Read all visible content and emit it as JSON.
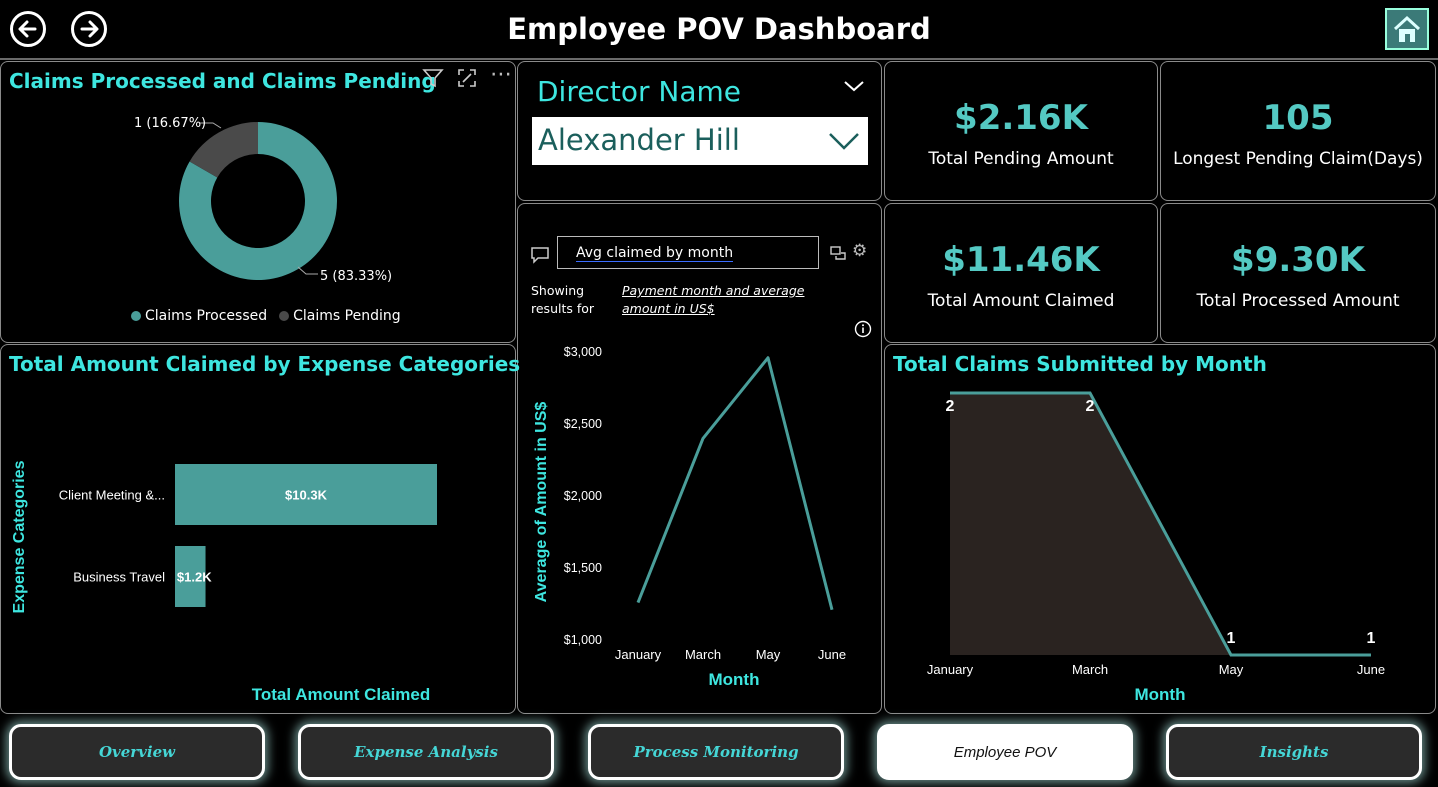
{
  "header": {
    "title": "Employee POV Dashboard",
    "back_icon": "arrow-left-icon",
    "forward_icon": "arrow-right-icon",
    "home_icon": "home-icon"
  },
  "claims_donut": {
    "title": "Claims Processed and Claims Pending",
    "pending_label": "1 (16.67%)",
    "processed_label": "5 (83.33%)",
    "legend_processed": "Claims Processed",
    "legend_pending": "Claims Pending",
    "colors": {
      "processed": "#4a9e9a",
      "pending": "#4a4a4a"
    }
  },
  "director": {
    "label": "Director Name",
    "selected": "Alexander Hill"
  },
  "kpis": [
    {
      "value": "$2.16K",
      "label": "Total Pending Amount"
    },
    {
      "value": "105",
      "label": "Longest Pending Claim(Days)"
    },
    {
      "value": "$11.46K",
      "label": "Total Amount Claimed"
    },
    {
      "value": "$9.30K",
      "label": "Total Processed Amount"
    }
  ],
  "qa": {
    "query": "Avg claimed by month",
    "showing": "Showing results for",
    "interpretation": "Payment month and average amount in US$"
  },
  "bar_chart": {
    "title": "Total Amount Claimed by Expense Categories",
    "xlabel": "Total Amount Claimed",
    "ylabel": "Expense Categories",
    "categories": [
      "Client Meeting &...",
      "Business Travel"
    ],
    "value_labels": [
      "$10.3K",
      "$1.2K"
    ]
  },
  "avg_chart": {
    "ylabel": "Average of Amount in US$",
    "xlabel": "Month",
    "y_ticks": [
      "$3,000",
      "$2,500",
      "$2,000",
      "$1,500",
      "$1,000"
    ],
    "x_ticks": [
      "January",
      "March",
      "May",
      "June"
    ]
  },
  "area_chart": {
    "title": "Total Claims Submitted by Month",
    "xlabel": "Month",
    "x_ticks": [
      "January",
      "March",
      "May",
      "June"
    ],
    "point_labels": [
      "2",
      "2",
      "1",
      "1"
    ]
  },
  "chart_data": [
    {
      "type": "pie",
      "title": "Claims Processed and Claims Pending",
      "categories": [
        "Claims Processed",
        "Claims Pending"
      ],
      "values": [
        5,
        1
      ]
    },
    {
      "type": "bar",
      "title": "Total Amount Claimed by Expense Categories",
      "categories": [
        "Client Meeting &...",
        "Business Travel"
      ],
      "values": [
        10300,
        1200
      ],
      "xlabel": "Total Amount Claimed",
      "ylabel": "Expense Categories"
    },
    {
      "type": "line",
      "x": [
        "January",
        "March",
        "May",
        "June"
      ],
      "values": [
        1260,
        2400,
        2960,
        1210
      ],
      "xlabel": "Month",
      "ylabel": "Average of Amount in US$",
      "ylim": [
        1000,
        3000
      ]
    },
    {
      "type": "area",
      "title": "Total Claims Submitted by Month",
      "x": [
        "January",
        "March",
        "May",
        "June"
      ],
      "values": [
        2,
        2,
        1,
        1
      ],
      "xlabel": "Month"
    }
  ],
  "tabs": [
    {
      "label": "Overview",
      "active": false
    },
    {
      "label": "Expense Analysis",
      "active": false
    },
    {
      "label": "Process Monitoring",
      "active": false
    },
    {
      "label": "Employee POV",
      "active": true
    },
    {
      "label": "Insights",
      "active": false
    }
  ]
}
